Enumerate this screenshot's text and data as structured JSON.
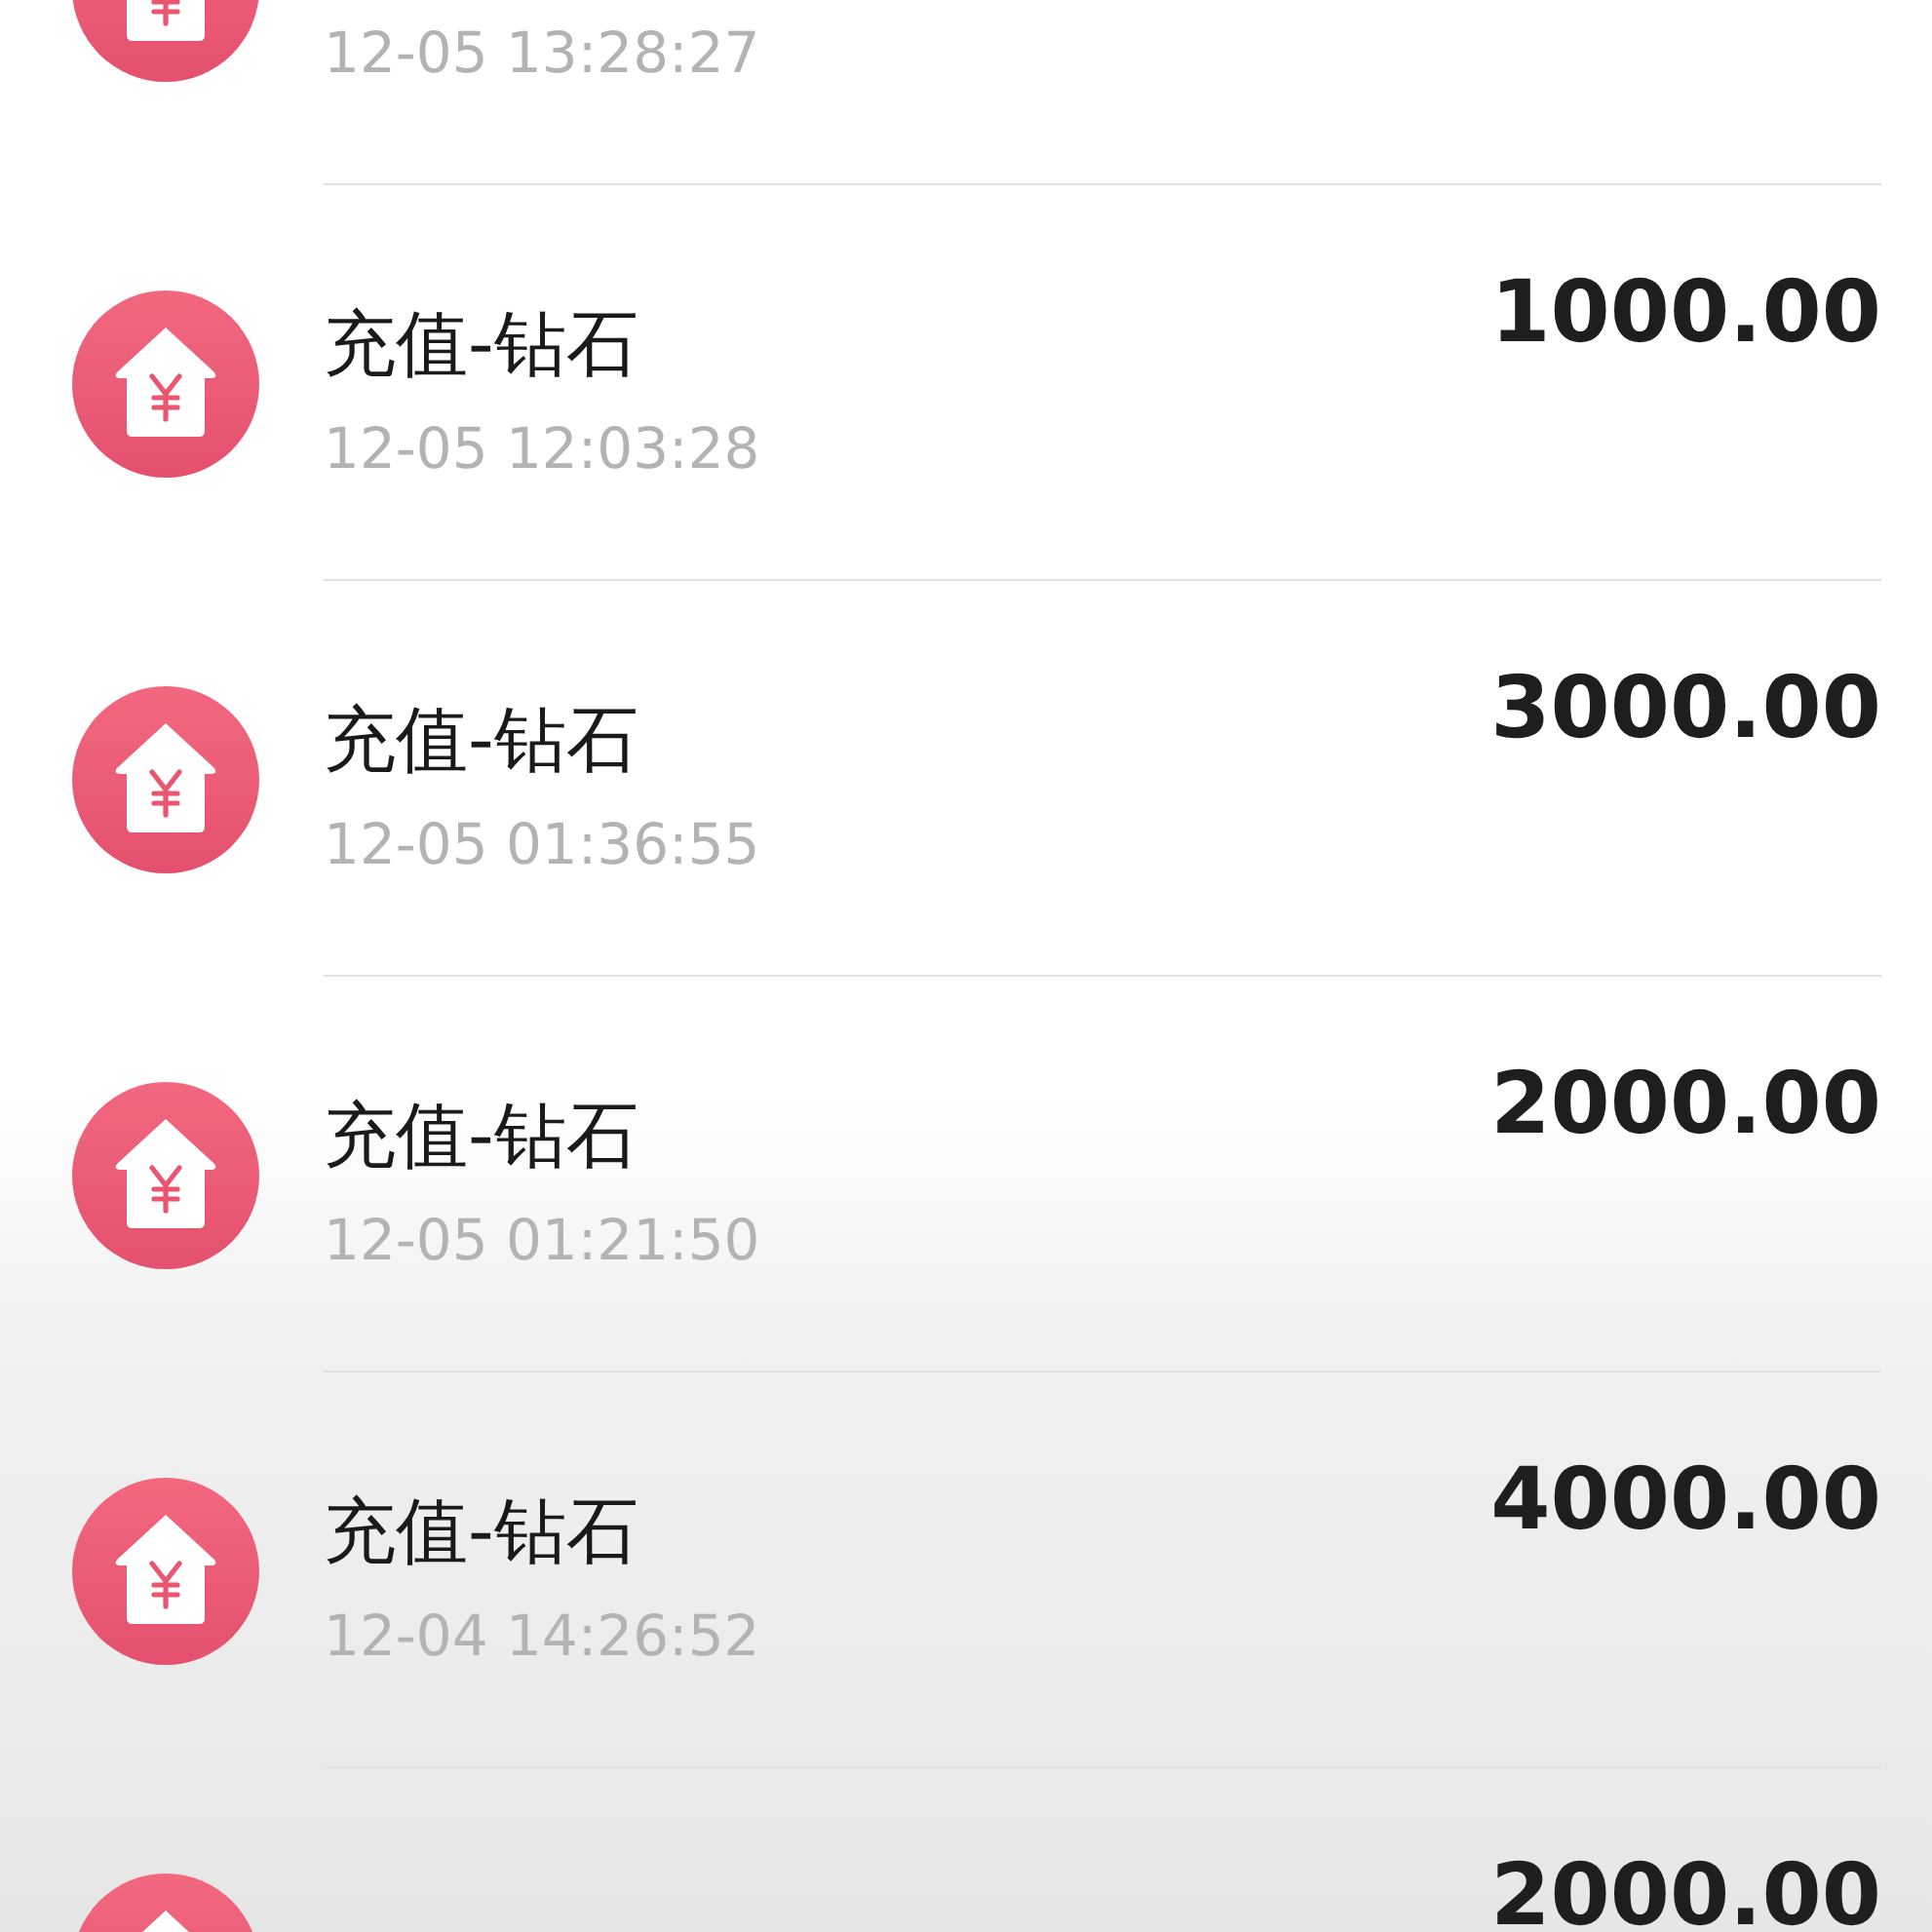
{
  "transactions": [
    {
      "time": "12-05 13:28:27"
    },
    {
      "title": "充值-钻石",
      "time": "12-05 12:03:28",
      "amount": "1000.00"
    },
    {
      "title": "充值-钻石",
      "time": "12-05 01:36:55",
      "amount": "3000.00"
    },
    {
      "title": "充值-钻石",
      "time": "12-05 01:21:50",
      "amount": "2000.00"
    },
    {
      "title": "充值-钻石",
      "time": "12-04 14:26:52",
      "amount": "4000.00"
    },
    {
      "amount": "2000.00"
    }
  ]
}
